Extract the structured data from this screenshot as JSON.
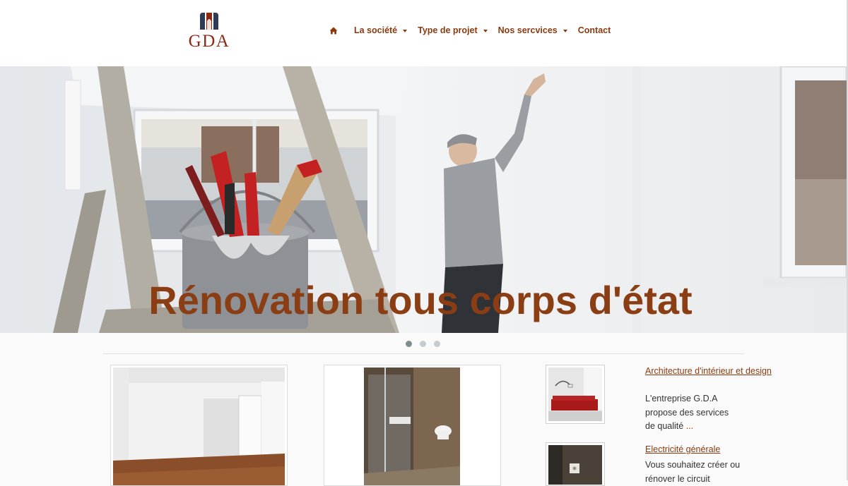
{
  "header": {
    "logo_text": "GDA",
    "nav": [
      {
        "label": "La société"
      },
      {
        "label": "Type de projet"
      },
      {
        "label": "Nos sercvices"
      },
      {
        "label": "Contact"
      }
    ]
  },
  "hero": {
    "title": "Rénovation tous corps d'état",
    "active_slide": 1,
    "slide_count": 3
  },
  "sidebar": {
    "items": [
      {
        "title": "Architecture d'intérieur et design",
        "text": "L'entreprise G.D.A propose des services de qualité",
        "more": "..."
      },
      {
        "title": "Electricité générale",
        "text": "Vous souhaitez créer ou rénover le circuit"
      }
    ]
  },
  "colors": {
    "accent": "#8b3a10",
    "title": "#8b3e14"
  }
}
